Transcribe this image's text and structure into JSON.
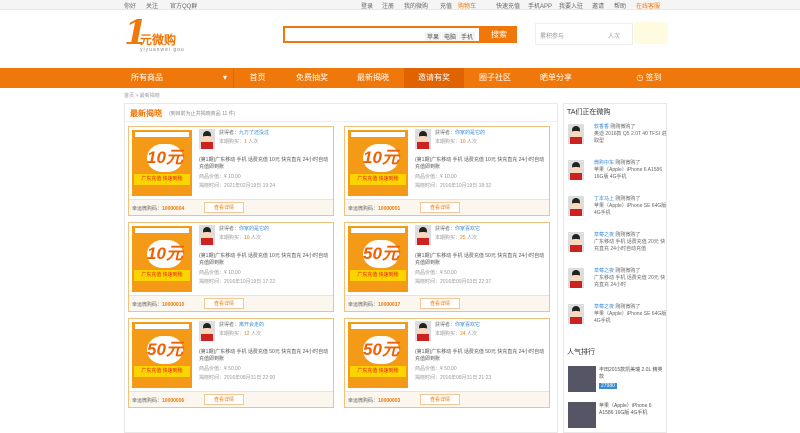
{
  "topbar": {
    "items": [
      "你好",
      "关注",
      "官方QQ群",
      "登录",
      "注册",
      "我的微购",
      "充值",
      "购物车",
      "快速充值",
      "手机APP",
      "我要入驻",
      "邀请",
      "帮助",
      "在线客服"
    ]
  },
  "header": {
    "logo_big": "1",
    "logo_text": "元微购",
    "logo_sub": "yiyuanwei gou",
    "search_tags": [
      "苹果",
      "电脑",
      "手机"
    ],
    "search_btn": "搜索",
    "hot_label": "累积参与",
    "hot_unit": "人次"
  },
  "nav": {
    "all": "所有商品",
    "items": [
      "首页",
      "免费抽奖",
      "最新揭晓",
      "邀请有奖",
      "圈子社区",
      "晒单分享"
    ],
    "signin": "签到"
  },
  "breadcrumb": "首页 > 最新揭晓",
  "main": {
    "title": "最新揭晓",
    "subtitle": "(到目前为止共揭晓商品 11 件)"
  },
  "cards": [
    {
      "winner": "九万了还没过",
      "buys": "1",
      "price": "10元",
      "title": "(第1期)广东移动  手机  话费充值  10元  快充直充 24小时自动充值即到账",
      "value": "商品价值：¥ 10.00",
      "time": "揭晓时间：2021年02月19日 19:24",
      "code": "10000004"
    },
    {
      "winner": "你家的是它的",
      "buys": "10",
      "price": "10元",
      "title": "(第1期)广东移动  手机  话费充值  10元  快充直充 24小时自动充值即到账",
      "value": "商品价值：¥ 10.00",
      "time": "揭晓时间：2016年10月19日 18:32",
      "code": "10000001"
    },
    {
      "winner": "你家的是它的",
      "buys": "10",
      "price": "10元",
      "title": "(第1期)广东移动  手机  话费充值  10元  快充直充 24小时自动充值即到账",
      "value": "商品价值：¥ 10.00",
      "time": "揭晓时间：2016年10月19日 17:22",
      "code": "10000010"
    },
    {
      "winner": "你家喜欢它",
      "buys": "25",
      "price": "50元",
      "title": "(第1期)广东移动  手机  话费充值  50元  快充直充 24小时自动充值即到账",
      "value": "商品价值：¥ 50.00",
      "time": "揭晓时间：2016年09月03日 22:37",
      "code": "10000017"
    },
    {
      "winner": "离开会走的",
      "buys": "12",
      "price": "50元",
      "title": "(第1期)广东移动  手机  话费充值  50元  快充直充 24小时自动充值即到账",
      "value": "商品价值：¥ 50.00",
      "time": "揭晓时间：2016年08月31日 22:00",
      "code": "10000006"
    },
    {
      "winner": "你家喜欢它",
      "buys": "24",
      "price": "50元",
      "title": "(第1期)广东移动  手机  话费充值  50元  快充直充 24小时自动充值即到账",
      "value": "商品价值：¥ 50.00",
      "time": "揭晓时间：2016年08月31日 21:23",
      "code": "10000003"
    }
  ],
  "card_labels": {
    "winner_prefix": "获得者：",
    "buys_prefix": "本期购买：",
    "buys_suffix": "人次",
    "lucky": "幸运微购码：",
    "detail": "查看详情",
    "ribbon": "广东充值  快速到账"
  },
  "side": {
    "title": "TA们正在微购",
    "buyers": [
      {
        "name": "软香香",
        "action": "刚刚微购了",
        "item": "奥迪 2016款 Q5 2.0T 40 TFSI 进取型"
      },
      {
        "name": "微购中车",
        "action": "刚刚微购了",
        "item": "苹果（Apple）iPhone 6 A1586 16G版 4G手机"
      },
      {
        "name": "丁本马上",
        "action": "刚刚微购了",
        "item": "苹果（Apple）iPhone SE 64G版 4G手机"
      },
      {
        "name": "草莓之夜",
        "action": "刚刚微购了",
        "item": "广东移动 手机 话费充值 20元 快充直充 24小时自动充值"
      },
      {
        "name": "草莓之夜",
        "action": "刚刚微购了",
        "item": "广东移动 手机 话费充值 20元 快充直充 24小时"
      },
      {
        "name": "草莓之夜",
        "action": "刚刚微购了",
        "item": "苹果（Apple）iPhone SE 64G版 4G手机"
      }
    ],
    "hot_title": "人气排行",
    "ranks": [
      {
        "title": "丰田2015款凯美瑞 2.0L 精英款",
        "price": "27980"
      },
      {
        "title": "苹果（Apple）iPhone 6 A1586 16G版 4G手机",
        "price": ""
      }
    ]
  }
}
